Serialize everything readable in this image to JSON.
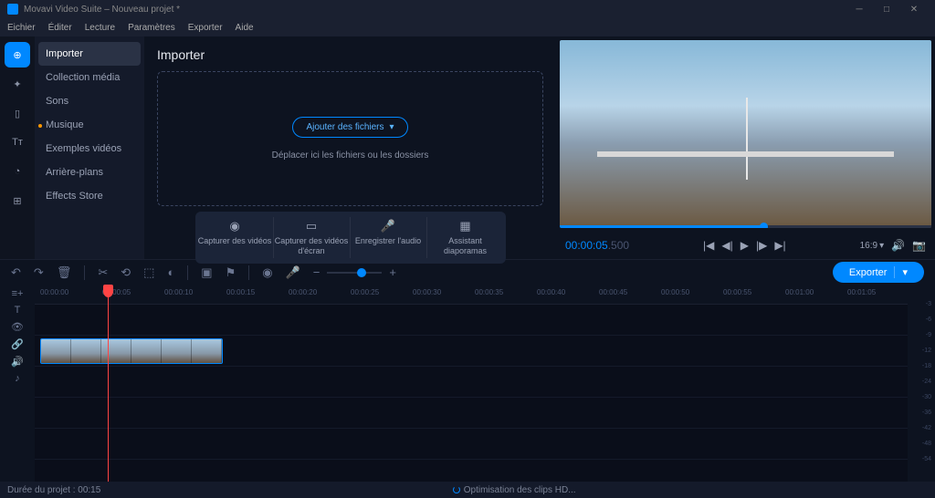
{
  "window": {
    "title": "Movavi Video Suite – Nouveau projet *"
  },
  "menu": {
    "file": "Eichier",
    "edit": "Éditer",
    "play": "Lecture",
    "settings": "Paramètres",
    "export": "Exporter",
    "help": "Aide"
  },
  "sidebar": {
    "items": [
      {
        "label": "Importer",
        "active": true
      },
      {
        "label": "Collection média"
      },
      {
        "label": "Sons"
      },
      {
        "label": "Musique",
        "dot": true
      },
      {
        "label": "Exemples vidéos"
      },
      {
        "label": "Arrière-plans"
      },
      {
        "label": "Effects Store"
      }
    ]
  },
  "content": {
    "heading": "Importer",
    "add_files": "Ajouter des fichiers",
    "drop_hint": "Déplacer ici les fichiers ou les dossiers"
  },
  "capture": {
    "video": "Capturer des vidéos",
    "screen": "Capturer des vidéos d'écran",
    "audio": "Enregistrer l'audio",
    "slideshow": "Assistant diaporamas"
  },
  "preview": {
    "time": "00:00:05",
    "time_ms": ".500",
    "aspect": "16:9"
  },
  "toolbar": {
    "export": "Exporter"
  },
  "ruler": [
    "00:00:00",
    "00:00:05",
    "00:00:10",
    "00:00:15",
    "00:00:20",
    "00:00:25",
    "00:00:30",
    "00:00:35",
    "00:00:40",
    "00:00:45",
    "00:00:50",
    "00:00:55",
    "00:01:00",
    "00:01:05"
  ],
  "meters": [
    "-3",
    "-6",
    "-9",
    "-12",
    "-18",
    "-24",
    "-30",
    "-36",
    "-42",
    "-48",
    "-54"
  ],
  "status": {
    "duration": "Durée du projet : 00:15",
    "optimizing": "Optimisation des clips HD..."
  }
}
